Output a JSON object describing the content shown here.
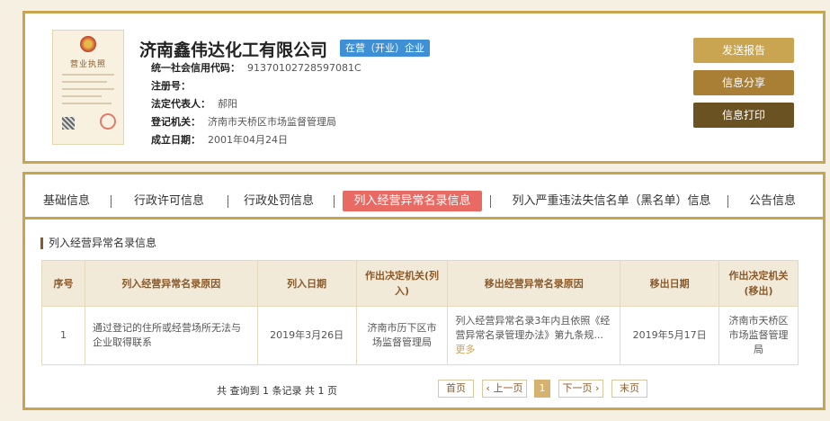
{
  "company": {
    "name": "济南鑫伟达化工有限公司",
    "status": "在营（开业）企业",
    "license_title": "营业执照"
  },
  "info": [
    {
      "label": "统一社会信用代码：",
      "value": "91370102728597081C"
    },
    {
      "label": "注册号：",
      "value": ""
    },
    {
      "label": "法定代表人：",
      "value": "郝阳"
    },
    {
      "label": "登记机关：",
      "value": "济南市天桥区市场监督管理局"
    },
    {
      "label": "成立日期：",
      "value": "2001年04月24日"
    }
  ],
  "actions": {
    "send": "发送报告",
    "share": "信息分享",
    "print": "信息打印"
  },
  "tabs": [
    "基础信息",
    "行政许可信息",
    "行政处罚信息",
    "列入经营异常名录信息",
    "列入严重违法失信名单（黑名单）信息",
    "公告信息"
  ],
  "active_tab": 3,
  "section_title": "列入经营异常名录信息",
  "table": {
    "headers": [
      "序号",
      "列入经营异常名录原因",
      "列入日期",
      "作出决定机关(列入)",
      "移出经营异常名录原因",
      "移出日期",
      "作出决定机关(移出)"
    ],
    "row": {
      "index": "1",
      "reason_in": "通过登记的住所或经营场所无法与企业取得联系",
      "date_in": "2019年3月26日",
      "authority_in": "济南市历下区市场监督管理局",
      "reason_out": "列入经营异常名录3年内且依照《经营异常名录管理办法》第九条规...",
      "more": "更多",
      "date_out": "2019年5月17日",
      "authority_out": "济南市天桥区市场监督管理局"
    }
  },
  "pager": {
    "total": "共 查询到 1 条记录 共 1 页",
    "first": "首页",
    "prev": "‹ 上一页",
    "current": "1",
    "next": "下一页 ›",
    "last": "末页"
  },
  "colors": {
    "gold": "#c9a552",
    "badge_blue": "#3d8fd6",
    "active_tab": "#e86a63",
    "dark_brown": "#6b5223"
  }
}
